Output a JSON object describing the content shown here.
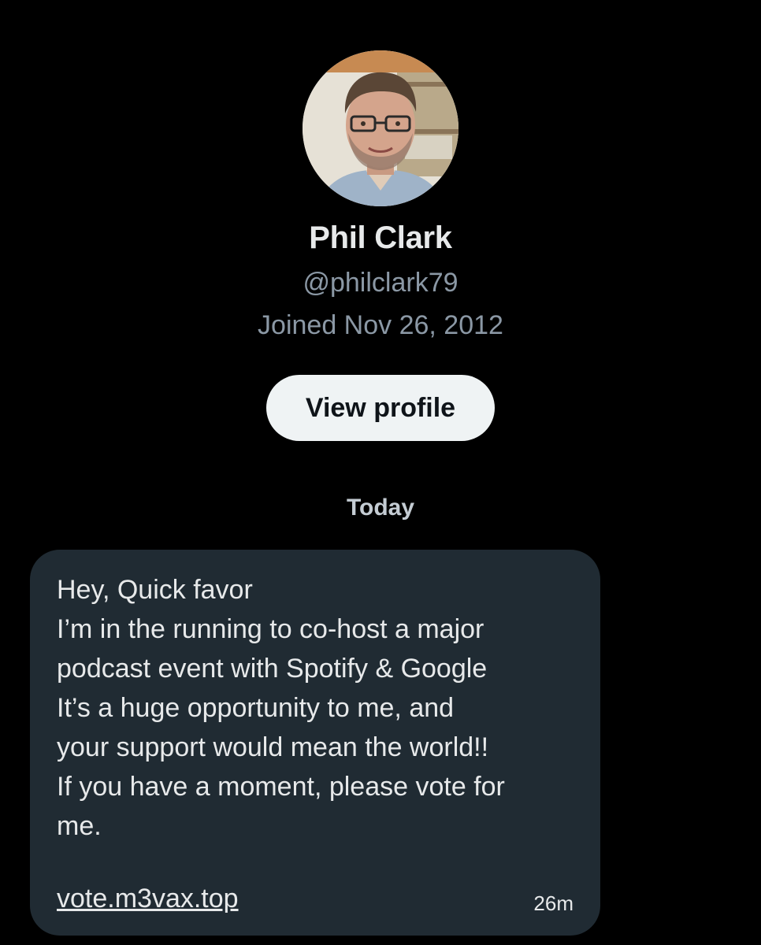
{
  "profile": {
    "name": "Phil Clark",
    "handle": "@philclark79",
    "joined": "Joined Nov 26, 2012",
    "view_profile_label": "View profile"
  },
  "conversation": {
    "day_label": "Today",
    "message": {
      "lines": [
        "Hey, Quick favor",
        "I’m in the running to co-host a major",
        "podcast event with Spotify & Google",
        "It’s a huge opportunity to me, and",
        "your support would mean the world!!",
        "If you have a moment, please vote for",
        "me."
      ],
      "link": "vote.m3vax.top",
      "time": "26m"
    }
  },
  "colors": {
    "background": "#000000",
    "bubble": "#202b33",
    "primary_text": "#e7e9ea",
    "secondary_text": "#8b98a5",
    "button_bg": "#eff3f4",
    "button_text": "#0f1419"
  }
}
